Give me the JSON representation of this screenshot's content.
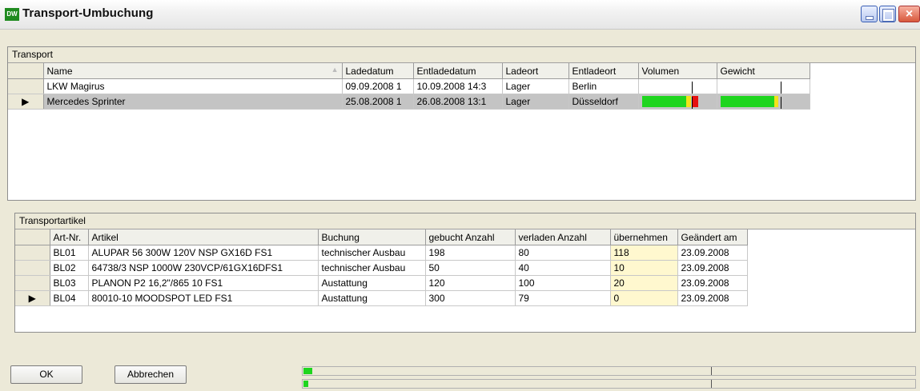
{
  "window": {
    "title": "Transport-Umbuchung",
    "icon_label": "DW",
    "close_glyph": "×"
  },
  "transport": {
    "group_title": "Transport",
    "columns": [
      "Name",
      "Ladedatum",
      "Entladedatum",
      "Ladeort",
      "Entladeort",
      "Volumen",
      "Gewicht"
    ],
    "rows": [
      {
        "name": "LKW Magirus",
        "ladedatum": "09.09.2008 1",
        "entladedatum": "10.09.2008 14:3",
        "ladeort": "Lager",
        "entladeort": "Berlin",
        "volumen_fill": 0,
        "gewicht_fill": 0,
        "selected": false
      },
      {
        "name": "Mercedes Sprinter",
        "ladedatum": "25.08.2008 1",
        "entladedatum": "26.08.2008 13:1",
        "ladeort": "Lager",
        "entladeort": "Düsseldorf",
        "volumen_fill": 1.14,
        "gewicht_fill": 0.97,
        "selected": true
      }
    ]
  },
  "artikel": {
    "group_title": "Transportartikel",
    "columns": [
      "Art-Nr.",
      "Artikel",
      "Buchung",
      "gebucht Anzahl",
      "verladen Anzahl",
      "übernehmen",
      "Geändert am"
    ],
    "rows": [
      {
        "artnr": "BL01",
        "artikel": "ALUPAR 56 300W 120V NSP GX16D FS1",
        "buchung": "technischer Ausbau",
        "gebucht": "198",
        "verladen": "80",
        "uebernehmen": "118",
        "geaendert": "23.09.2008",
        "selected": false
      },
      {
        "artnr": "BL02",
        "artikel": "64738/3 NSP 1000W 230VCP/61GX16DFS1",
        "buchung": "technischer Ausbau",
        "gebucht": "50",
        "verladen": "40",
        "uebernehmen": "10",
        "geaendert": "23.09.2008",
        "selected": false
      },
      {
        "artnr": "BL03",
        "artikel": "PLANON P2 16,2\"/865 10 FS1",
        "buchung": "Austattung",
        "gebucht": "120",
        "verladen": "100",
        "uebernehmen": "20",
        "geaendert": "23.09.2008",
        "selected": false
      },
      {
        "artnr": "BL04",
        "artikel": "80010-10 MOODSPOT LED FS1",
        "buchung": "Austattung",
        "gebucht": "300",
        "verladen": "79",
        "uebernehmen": "0",
        "geaendert": "23.09.2008",
        "selected": true
      }
    ]
  },
  "footer": {
    "ok_label": "OK",
    "cancel_label": "Abbrechen",
    "progress1_fill": 0.02,
    "progress2_fill": 0.01
  },
  "colors": {
    "green": "#1fd51f",
    "yellow": "#f2e21a",
    "red": "#e61010"
  }
}
